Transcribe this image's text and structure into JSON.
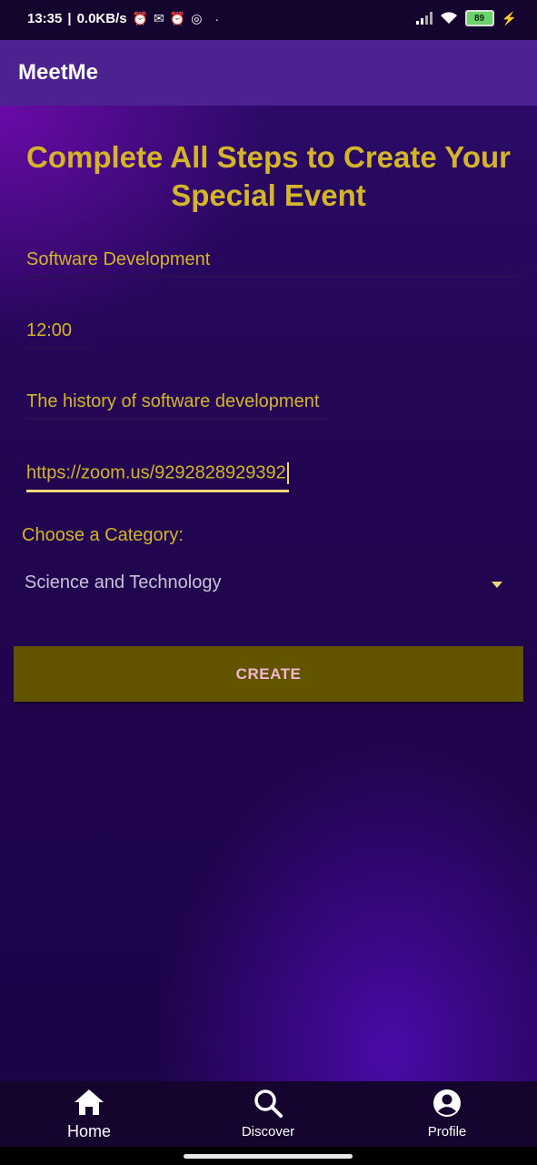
{
  "status_bar": {
    "time": "13:35",
    "network_speed": "0.0KB/s",
    "battery": "89",
    "icons": [
      "alarm-icon",
      "gmail-icon",
      "alarm-icon",
      "app-icon",
      "dot-icon",
      "signal-icon",
      "wifi-icon",
      "battery-icon",
      "charging-icon"
    ]
  },
  "app_bar": {
    "title": "MeetMe"
  },
  "form": {
    "heading": "Complete All Steps to Create Your Special Event",
    "title_value": "Software Development",
    "time_value": "12:00",
    "description_value": "The history of software development",
    "link_value": "https://zoom.us/9292828929392",
    "category_label": "Choose a Category:",
    "category_selected": "Science and Technology",
    "create_label": "CREATE"
  },
  "bottom_nav": {
    "items": [
      {
        "label": "Home",
        "icon": "home-icon",
        "active": true
      },
      {
        "label": "Discover",
        "icon": "search-icon",
        "active": false
      },
      {
        "label": "Profile",
        "icon": "account-circle-icon",
        "active": false
      }
    ]
  },
  "colors": {
    "accent": "#d4b52a",
    "app_bar": "#4b2290",
    "button": "#635400",
    "button_text": "#f2b6d0",
    "nav_background": "#14042e"
  }
}
